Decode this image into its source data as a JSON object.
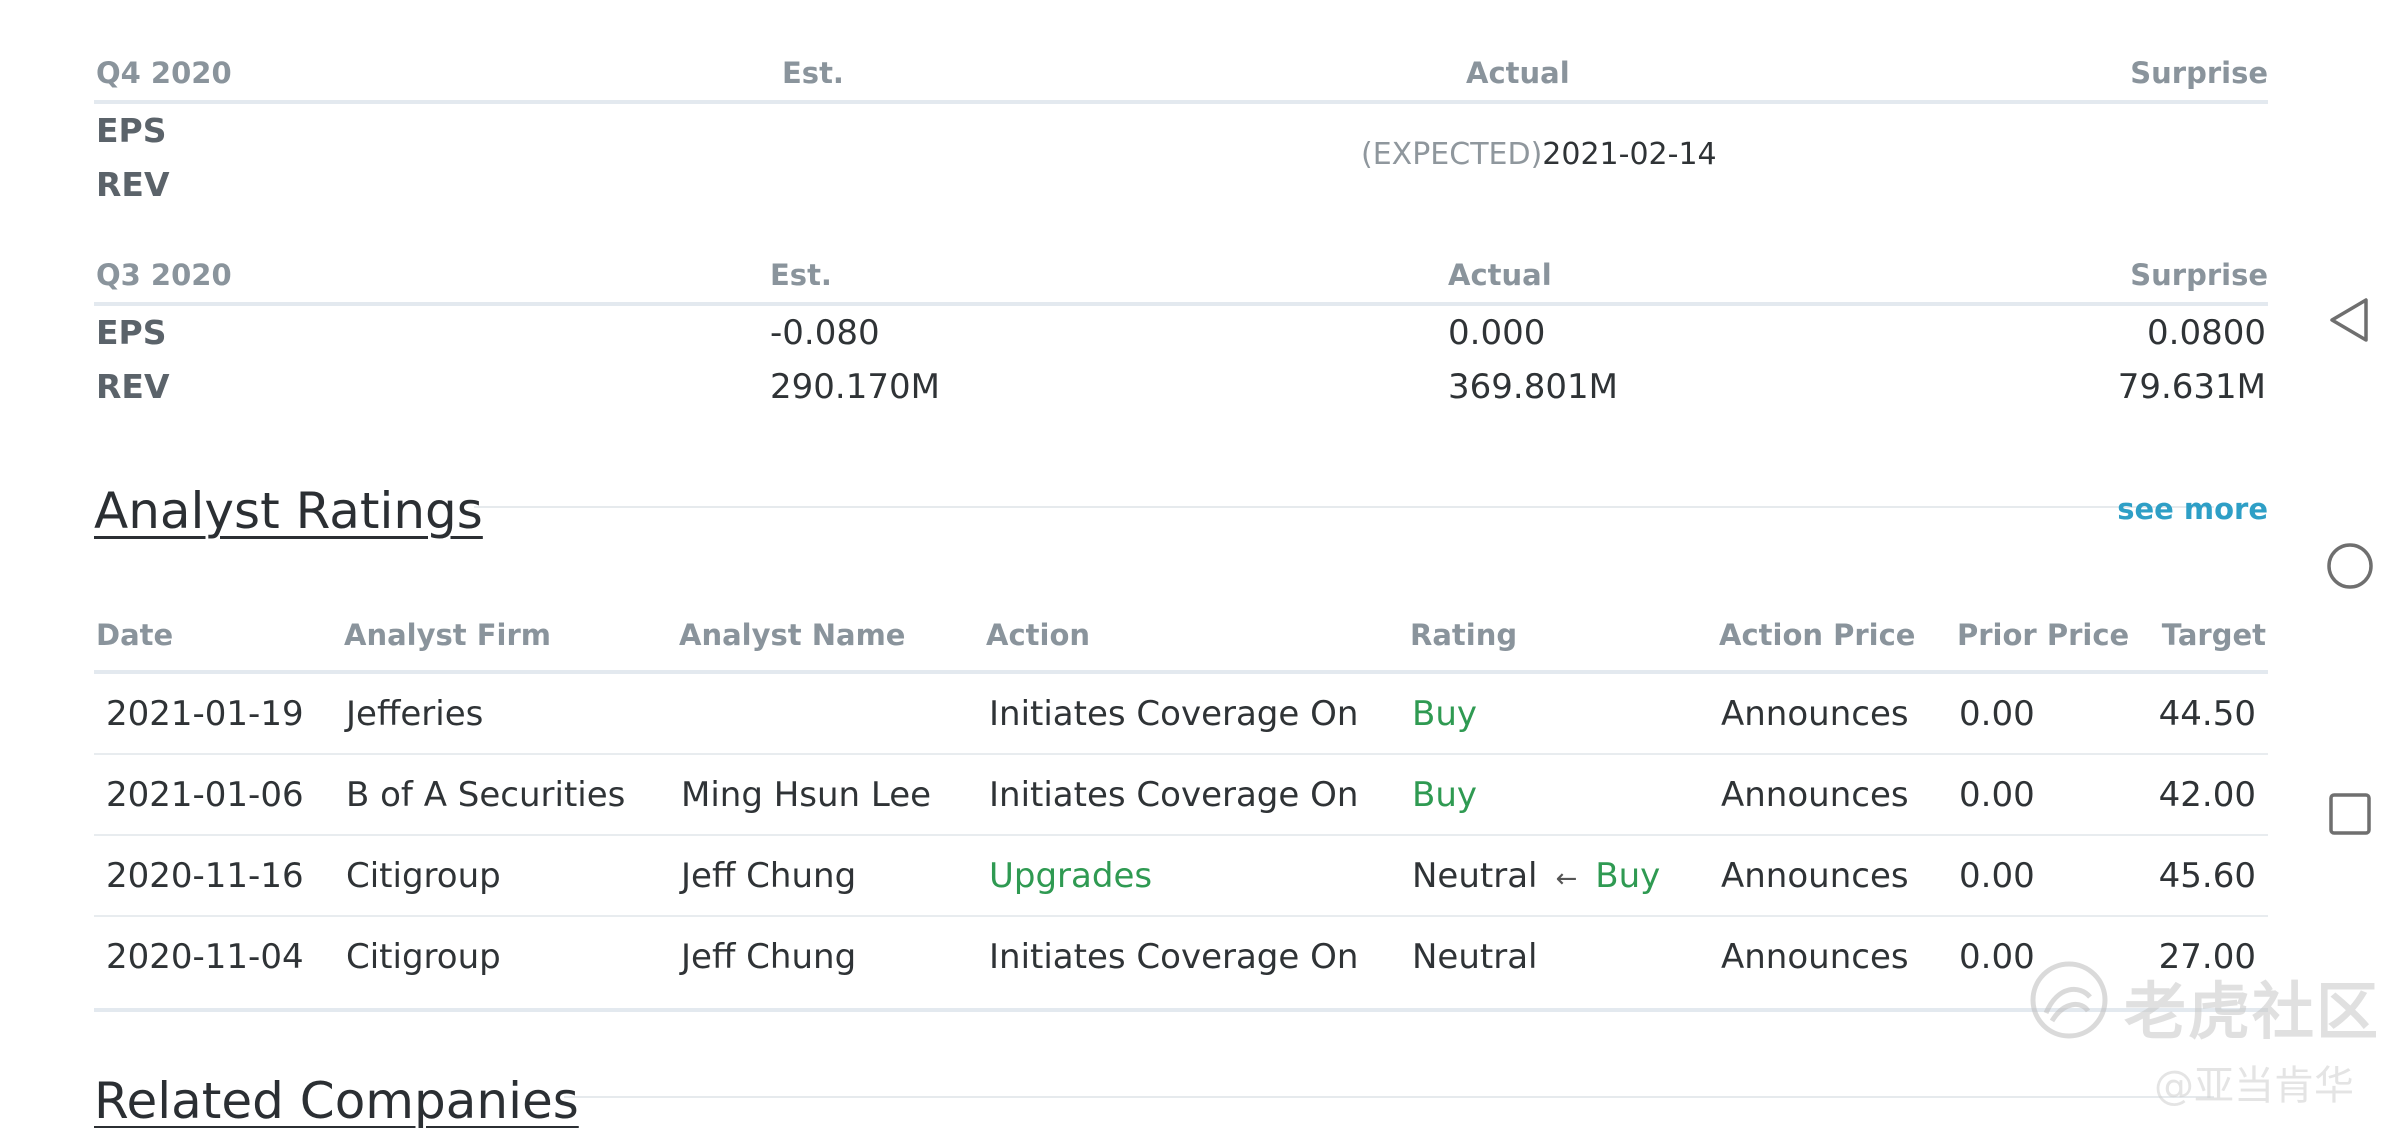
{
  "earnings": [
    {
      "quarter": "Q4 2020",
      "est_label": "Est.",
      "actual_label": "Actual",
      "surprise_label": "Surprise",
      "eps_label": "EPS",
      "rev_label": "REV",
      "expected_tag": "(EXPECTED)",
      "expected_date": "2021-02-14"
    },
    {
      "quarter": "Q3 2020",
      "est_label": "Est.",
      "actual_label": "Actual",
      "surprise_label": "Surprise",
      "eps_label": "EPS",
      "rev_label": "REV",
      "eps": {
        "est": "-0.080",
        "actual": "0.000",
        "surprise": "0.0800"
      },
      "rev": {
        "est": "290.170M",
        "actual": "369.801M",
        "surprise": "79.631M"
      }
    }
  ],
  "analyst_ratings": {
    "title": "Analyst Ratings",
    "see_more": "see more",
    "columns": [
      "Date",
      "Analyst Firm",
      "Analyst Name",
      "Action",
      "Rating",
      "Action Price",
      "Prior Price",
      "Target"
    ],
    "rows": [
      {
        "date": "2021-01-19",
        "firm": "Jefferies",
        "name": "",
        "action": "Initiates Coverage On",
        "rating_from": "",
        "rating": "Buy",
        "action_price": "Announces",
        "prior_price": "0.00",
        "target": "44.50"
      },
      {
        "date": "2021-01-06",
        "firm": "B of A Securities",
        "name": "Ming Hsun Lee",
        "action": "Initiates Coverage On",
        "rating_from": "",
        "rating": "Buy",
        "action_price": "Announces",
        "prior_price": "0.00",
        "target": "42.00"
      },
      {
        "date": "2020-11-16",
        "firm": "Citigroup",
        "name": "Jeff Chung",
        "action": "Upgrades",
        "rating_from": "Neutral",
        "arrow": "←",
        "rating": "Buy",
        "action_price": "Announces",
        "prior_price": "0.00",
        "target": "45.60"
      },
      {
        "date": "2020-11-04",
        "firm": "Citigroup",
        "name": "Jeff Chung",
        "action": "Initiates Coverage On",
        "rating_from": "",
        "rating": "Neutral",
        "action_price": "Announces",
        "prior_price": "0.00",
        "target": "27.00"
      }
    ]
  },
  "related_companies": {
    "title": "Related Companies"
  },
  "watermark": {
    "main": "老虎社区",
    "sub": "@亚当肯华"
  },
  "nav": {
    "back_icon": "triangle-back-icon",
    "home_icon": "circle-home-icon",
    "recents_icon": "square-recents-icon"
  },
  "colors": {
    "accent_link": "#2e9fc6",
    "positive": "#2f9a52",
    "header_text": "#8a949c"
  }
}
